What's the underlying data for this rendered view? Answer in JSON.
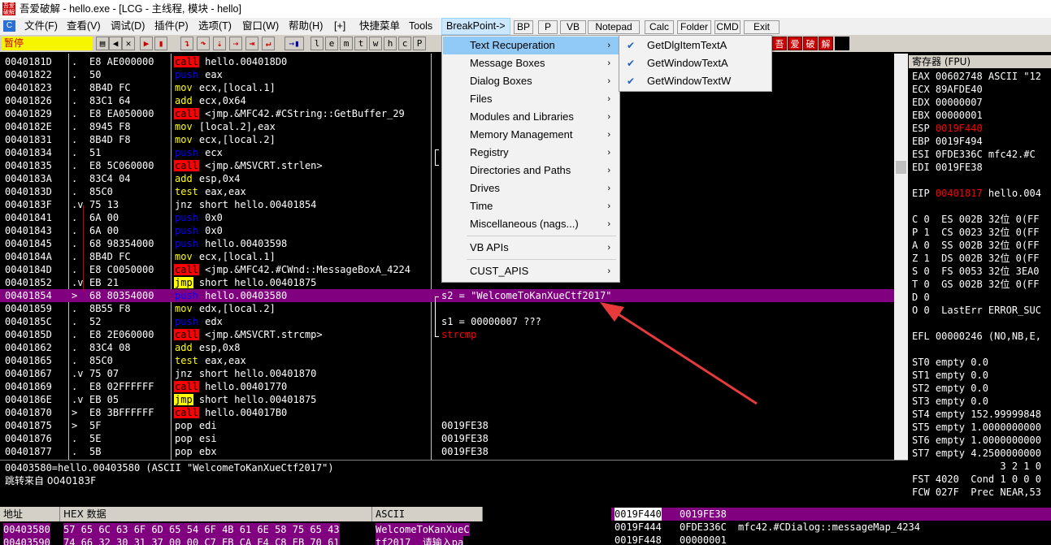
{
  "window": {
    "title": "吾爱破解 - hello.exe - [LCG - 主线程, 模块 - hello]",
    "icon": "app-logo-icon"
  },
  "menubar": {
    "items": [
      "文件(F)",
      "查看(V)",
      "调试(D)",
      "插件(P)",
      "选项(T)",
      "窗口(W)",
      "帮助(H)",
      "[+]",
      "快捷菜单",
      "Tools",
      "BreakPoint->"
    ],
    "plugin_buttons": [
      "BP",
      "P",
      "VB",
      "Notepad",
      "Calc",
      "Folder",
      "CMD",
      "Exit"
    ]
  },
  "toolbar": {
    "status": "暂停",
    "letter_buttons": [
      "l",
      "e",
      "m",
      "t",
      "w",
      "h",
      "c",
      "P"
    ],
    "crack_buttons": [
      "吾",
      "爱",
      "破",
      "解"
    ]
  },
  "disasm": {
    "rows": [
      {
        "addr": "0040181D",
        "mk": ".",
        "hex": "E8 AE000000",
        "op": "call",
        "args": " hello.004018D0",
        "comment": ""
      },
      {
        "addr": "00401822",
        "mk": ".",
        "hex": "50",
        "op": "push",
        "args": " eax",
        "comment": ""
      },
      {
        "addr": "00401823",
        "mk": ".",
        "hex": "8B4D FC",
        "op": "mov",
        "args": " ecx,[local.1]",
        "comment": ""
      },
      {
        "addr": "00401826",
        "mk": ".",
        "hex": "83C1 64",
        "op": "add",
        "args": " ecx,0x64",
        "comment": ""
      },
      {
        "addr": "00401829",
        "mk": ".",
        "hex": "E8 EA050000",
        "op": "call",
        "args": " <jmp.&MFC42.#CString::GetBuffer_29",
        "comment": ""
      },
      {
        "addr": "0040182E",
        "mk": ".",
        "hex": "8945 F8",
        "op": "mov",
        "args": " [local.2],eax",
        "comment": ""
      },
      {
        "addr": "00401831",
        "mk": ".",
        "hex": "8B4D F8",
        "op": "mov",
        "args": " ecx,[local.2]",
        "comment": ""
      },
      {
        "addr": "00401834",
        "mk": ".",
        "hex": "51",
        "op": "push",
        "args": " ecx",
        "comment": ""
      },
      {
        "addr": "00401835",
        "mk": ".",
        "hex": "E8 5C060000",
        "op": "call",
        "args": " <jmp.&MSVCRT.strlen>",
        "comment": ""
      },
      {
        "addr": "0040183A",
        "mk": ".",
        "hex": "83C4 04",
        "op": "add",
        "args": " esp,0x4",
        "comment": ""
      },
      {
        "addr": "0040183D",
        "mk": ".",
        "hex": "85C0",
        "op": "test",
        "args": " eax,eax",
        "comment": ""
      },
      {
        "addr": "0040183F",
        "mk": ".v",
        "hex": "75 13",
        "op": "jnz",
        "args": " short hello.00401854",
        "comment": ""
      },
      {
        "addr": "00401841",
        "mk": ".",
        "hex": "6A 00",
        "op": "push",
        "args": " 0x0",
        "comment": ""
      },
      {
        "addr": "00401843",
        "mk": ".",
        "hex": "6A 00",
        "op": "push",
        "args": " 0x0",
        "comment": ""
      },
      {
        "addr": "00401845",
        "mk": ".",
        "hex": "68 98354000",
        "op": "push",
        "args": " hello.00403598",
        "comment": ""
      },
      {
        "addr": "0040184A",
        "mk": ".",
        "hex": "8B4D FC",
        "op": "mov",
        "args": " ecx,[local.1]",
        "comment": ""
      },
      {
        "addr": "0040184D",
        "mk": ".",
        "hex": "E8 C0050000",
        "op": "call",
        "args": " <jmp.&MFC42.#CWnd::MessageBoxA_4224",
        "comment": ""
      },
      {
        "addr": "00401852",
        "mk": ".v",
        "hex": "EB 21",
        "op": "jmp",
        "args": " short hello.00401875",
        "comment": ""
      },
      {
        "addr": "00401854",
        "mk": ">",
        "hex": "68 80354000",
        "op": "push",
        "args": " hello.00403580",
        "comment": "s2 = \"WelcomeToKanXueCtf2017\"",
        "sel": true
      },
      {
        "addr": "00401859",
        "mk": ".",
        "hex": "8B55 F8",
        "op": "mov",
        "args": " edx,[local.2]",
        "comment": ""
      },
      {
        "addr": "0040185C",
        "mk": ".",
        "hex": "52",
        "op": "push",
        "args": " edx",
        "comment": "s1 = 00000007 ???"
      },
      {
        "addr": "0040185D",
        "mk": ".",
        "hex": "E8 2E060000",
        "op": "call",
        "args": " <jmp.&MSVCRT.strcmp>",
        "comment": "strcmp"
      },
      {
        "addr": "00401862",
        "mk": ".",
        "hex": "83C4 08",
        "op": "add",
        "args": " esp,0x8",
        "comment": ""
      },
      {
        "addr": "00401865",
        "mk": ".",
        "hex": "85C0",
        "op": "test",
        "args": " eax,eax",
        "comment": ""
      },
      {
        "addr": "00401867",
        "mk": ".v",
        "hex": "75 07",
        "op": "jnz",
        "args": " short hello.00401870",
        "comment": ""
      },
      {
        "addr": "00401869",
        "mk": ".",
        "hex": "E8 02FFFFFF",
        "op": "call",
        "args": " hello.00401770",
        "comment": ""
      },
      {
        "addr": "0040186E",
        "mk": ".v",
        "hex": "EB 05",
        "op": "jmp",
        "args": " short hello.00401875",
        "comment": ""
      },
      {
        "addr": "00401870",
        "mk": ">",
        "hex": "E8 3BFFFFFF",
        "op": "call",
        "args": " hello.004017B0",
        "comment": ""
      },
      {
        "addr": "00401875",
        "mk": ">",
        "hex": "5F",
        "op": "pop",
        "args": " edi",
        "comment": "0019FE38"
      },
      {
        "addr": "00401876",
        "mk": ".",
        "hex": "5E",
        "op": "pop",
        "args": " esi",
        "comment": "0019FE38"
      },
      {
        "addr": "00401877",
        "mk": ".",
        "hex": "5B",
        "op": "pop",
        "args": " ebx",
        "comment": "0019FE38"
      }
    ]
  },
  "registers": {
    "header": "寄存器 (FPU)",
    "rows": [
      {
        "t": "EAX 00602748 ASCII \"12",
        "red": false
      },
      {
        "t": "ECX 89AFDE40",
        "red": false
      },
      {
        "t": "EDX 00000007",
        "red": false
      },
      {
        "t": "EBX 00000001",
        "red": false
      },
      {
        "t": "ESP ",
        "v": "0019F440",
        "red": true
      },
      {
        "t": "EBP 0019F494",
        "red": false
      },
      {
        "t": "ESI 0FDE336C mfc42.#C",
        "red": false
      },
      {
        "t": "EDI 0019FE38",
        "red": false
      },
      {
        "t": "",
        "red": false
      },
      {
        "t": "EIP ",
        "v": "00401817",
        "tail": " hello.004",
        "red": true
      },
      {
        "t": "",
        "red": false
      },
      {
        "t": "C 0  ES 002B 32位 0(FF",
        "red": false
      },
      {
        "t": "P 1  CS 0023 32位 0(FF",
        "red": false
      },
      {
        "t": "A 0  SS 002B 32位 0(FF",
        "red": false
      },
      {
        "t": "Z 1  DS 002B 32位 0(FF",
        "red": false
      },
      {
        "t": "S 0  FS 0053 32位 3EA0",
        "red": false
      },
      {
        "t": "T 0  GS 002B 32位 0(FF",
        "red": false
      },
      {
        "t": "D 0",
        "red": false
      },
      {
        "t": "O 0  LastErr ERROR_SUC",
        "red": false
      },
      {
        "t": "",
        "red": false
      },
      {
        "t": "EFL 00000246 (NO,NB,E,",
        "red": false
      },
      {
        "t": "",
        "red": false
      },
      {
        "t": "ST0 empty 0.0",
        "red": false
      },
      {
        "t": "ST1 empty 0.0",
        "red": false
      },
      {
        "t": "ST2 empty 0.0",
        "red": false
      },
      {
        "t": "ST3 empty 0.0",
        "red": false
      },
      {
        "t": "ST4 empty 152.99999848",
        "red": false
      },
      {
        "t": "ST5 empty 1.0000000000",
        "red": false
      },
      {
        "t": "ST6 empty 1.0000000000",
        "red": false
      },
      {
        "t": "ST7 empty 4.2500000000",
        "red": false
      },
      {
        "t": "               3 2 1 0",
        "red": false
      },
      {
        "t": "FST 4020  Cond 1 0 0 0",
        "red": false
      },
      {
        "t": "FCW 027F  Prec NEAR,53",
        "red": false
      }
    ]
  },
  "info": {
    "line1": "00403580=hello.00403580 (ASCII \"WelcomeToKanXueCtf2017\")",
    "line2": "跳转来自 0040183F"
  },
  "dump": {
    "col_addr": "地址",
    "col_hex": "HEX 数据",
    "col_ascii": "ASCII",
    "rows": [
      {
        "addr": "00403580",
        "hex": "57 65 6C 63 6F 6D 65 54 6F 4B 61 6E 58 75 65 43",
        "ascii": "WelcomeToKanXueC"
      },
      {
        "addr": "00403590",
        "hex": "74 66 32 30 31 37 00 00 C7 EB CA E4 C8 EB 70 61",
        "ascii": "tf2017  请输入pa"
      }
    ]
  },
  "stack": {
    "rows": [
      {
        "addr": "0019F440",
        "val": "0019FE38",
        "comment": ""
      },
      {
        "addr": "0019F444",
        "val": "0FDE336C",
        "comment": "mfc42.#CDialog::messageMap_4234"
      },
      {
        "addr": "0019F448",
        "val": "00000001",
        "comment": ""
      }
    ]
  },
  "breakpoint_menu": {
    "items": [
      "Text Recuperation",
      "Message Boxes",
      "Dialog Boxes",
      "Files",
      "Modules and Libraries",
      "Memory Management",
      "Registry",
      "Directories and Paths",
      "Drives",
      "Time",
      "Miscellaneous (nags...)",
      "VB APIs",
      "CUST_APIS"
    ],
    "highlighted": "Text Recuperation"
  },
  "text_submenu": {
    "items": [
      "GetDlgItemTextA",
      "GetWindowTextA",
      "GetWindowTextW"
    ],
    "checked": [
      true,
      true,
      true
    ]
  },
  "colors": {
    "selection": "#800080",
    "call_bg": "#ff0000",
    "jmp_bg": "#ffff00",
    "annotation_arrow": "#e83a3a"
  }
}
